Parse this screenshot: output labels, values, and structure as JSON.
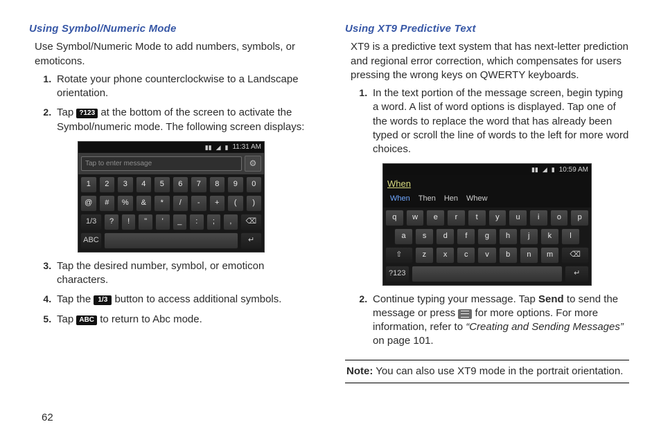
{
  "pageNumber": "62",
  "left": {
    "heading": "Using Symbol/Numeric Mode",
    "intro": "Use Symbol/Numeric Mode to add numbers, symbols, or emoticons.",
    "steps": {
      "s1": "Rotate your phone counterclockwise to a Landscape orientation.",
      "s2a": "Tap ",
      "s2_btn": "?123",
      "s2b": " at the bottom of the screen to activate the Symbol/numeric mode. The following screen displays:",
      "s3": "Tap the desired number, symbol, or emoticon characters.",
      "s4a": "Tap the ",
      "s4_btn": "1/3",
      "s4b": "  button to access additional symbols.",
      "s5a": "Tap ",
      "s5_btn": "ABC",
      "s5b": " to return to Abc mode."
    },
    "shot": {
      "time": "11:31 AM",
      "placeholder": "Tap to enter message",
      "row1": [
        "1",
        "2",
        "3",
        "4",
        "5",
        "6",
        "7",
        "8",
        "9",
        "0"
      ],
      "row2": [
        "@",
        "#",
        "%",
        "&",
        "*",
        "/",
        "-",
        "+",
        "(",
        ")"
      ],
      "row3": [
        "1/3",
        "?",
        "!",
        "\"",
        "'",
        "_",
        ":",
        ";",
        ",",
        "⌫"
      ],
      "row4": [
        "ABC",
        "",
        "↵"
      ]
    }
  },
  "right": {
    "heading": "Using XT9 Predictive Text",
    "intro": "XT9 is a predictive text system that has next-letter prediction and regional error correction, which compensates for users pressing the wrong keys on QWERTY keyboards.",
    "steps": {
      "s1": "In the text portion of the message screen, begin typing a word. A list of word options is displayed. Tap one of the words to replace the word that has already been typed or scroll the line of words to the left for more word choices.",
      "s2a": "Continue typing your message. Tap ",
      "s2_send": "Send",
      "s2b": " to send the message or press ",
      "s2c": " for more options. For more information, refer to ",
      "s2_ref": "“Creating and Sending Messages”",
      "s2d": "  on page 101."
    },
    "shot": {
      "time": "10:59 AM",
      "typed": "When",
      "preds": [
        "When",
        "Then",
        "Hen",
        "Whew"
      ],
      "row1": [
        "q",
        "w",
        "e",
        "r",
        "t",
        "y",
        "u",
        "i",
        "o",
        "p"
      ],
      "row2": [
        "a",
        "s",
        "d",
        "f",
        "g",
        "h",
        "j",
        "k",
        "l"
      ],
      "row3": [
        "⇧",
        "z",
        "x",
        "c",
        "v",
        "b",
        "n",
        "m",
        "⌫"
      ],
      "row4": [
        "?123",
        "",
        "↵"
      ]
    },
    "note_label": "Note:",
    "note_text": " You can also use XT9 mode in the portrait orientation."
  }
}
